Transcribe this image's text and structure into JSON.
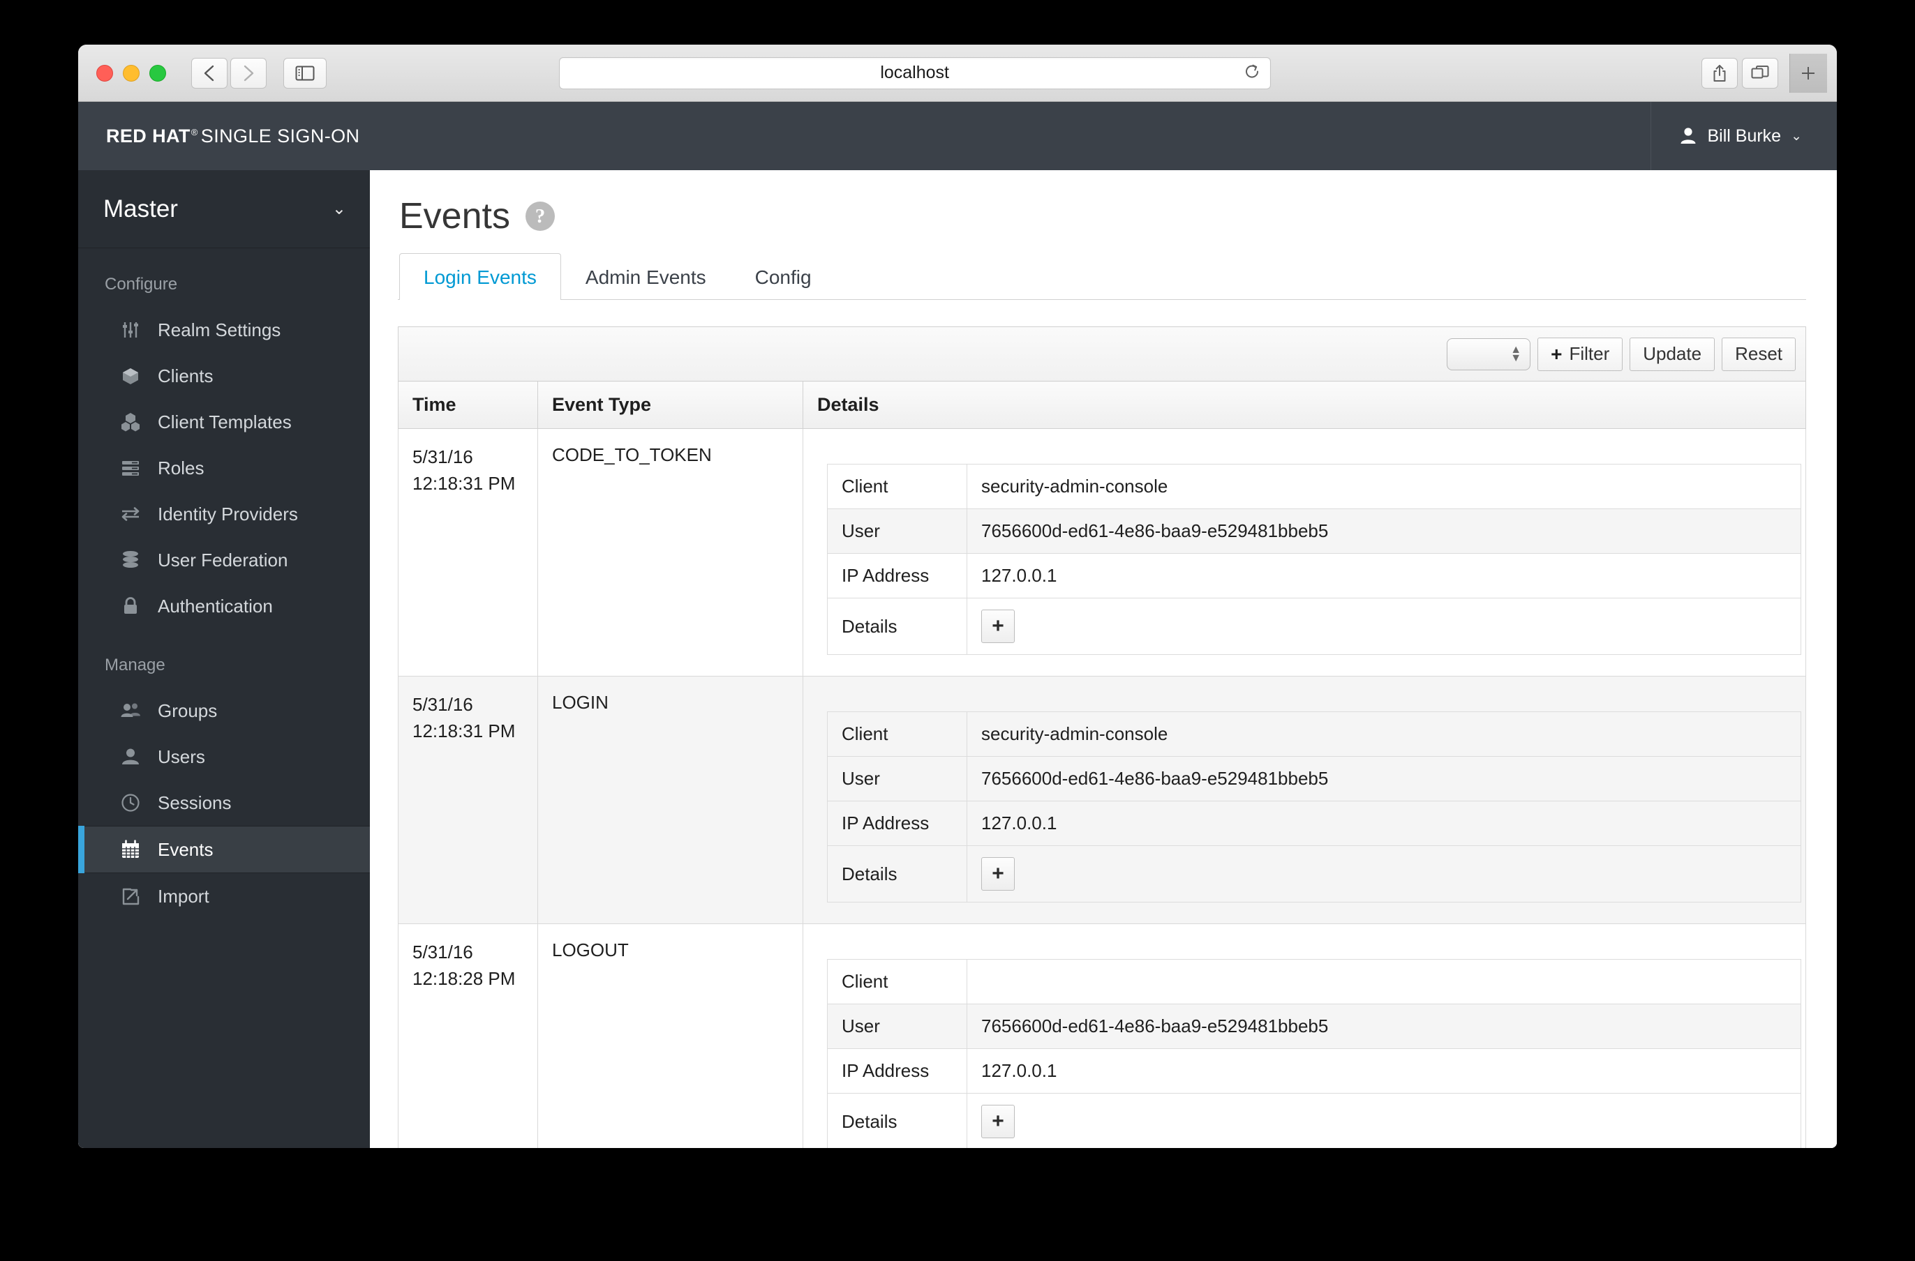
{
  "browser": {
    "url": "localhost",
    "back_label": "Back",
    "forward_label": "Forward",
    "sidebar_label": "Show Sidebar",
    "reload_label": "Reload",
    "share_label": "Share",
    "tabs_label": "Show Tab Overview",
    "newtab_label": "+"
  },
  "header": {
    "brand_bold": "RED HAT",
    "brand_reg": "®",
    "brand_light": "SINGLE SIGN-ON",
    "user_name": "Bill Burke",
    "user_caret": "⌄"
  },
  "sidebar": {
    "realm": "Master",
    "realm_caret": "⌄",
    "sections": [
      {
        "title": "Configure",
        "items": [
          {
            "label": "Realm Settings",
            "icon": "sliders-icon",
            "active": false
          },
          {
            "label": "Clients",
            "icon": "cube-icon",
            "active": false
          },
          {
            "label": "Client Templates",
            "icon": "cubes-icon",
            "active": false
          },
          {
            "label": "Roles",
            "icon": "list-icon",
            "active": false
          },
          {
            "label": "Identity Providers",
            "icon": "exchange-icon",
            "active": false
          },
          {
            "label": "User Federation",
            "icon": "database-icon",
            "active": false
          },
          {
            "label": "Authentication",
            "icon": "lock-icon",
            "active": false
          }
        ]
      },
      {
        "title": "Manage",
        "items": [
          {
            "label": "Groups",
            "icon": "users-icon",
            "active": false
          },
          {
            "label": "Users",
            "icon": "user-icon",
            "active": false
          },
          {
            "label": "Sessions",
            "icon": "clock-icon",
            "active": false
          },
          {
            "label": "Events",
            "icon": "calendar-icon",
            "active": true
          },
          {
            "label": "Import",
            "icon": "import-icon",
            "active": false
          }
        ]
      }
    ]
  },
  "main": {
    "page_title": "Events",
    "help_glyph": "?",
    "tabs": [
      {
        "label": "Login Events",
        "active": true
      },
      {
        "label": "Admin Events",
        "active": false
      },
      {
        "label": "Config",
        "active": false
      }
    ],
    "toolbar": {
      "select_value": "",
      "filter_label": "Filter",
      "filter_plus": "+",
      "update_label": "Update",
      "reset_label": "Reset"
    },
    "table": {
      "columns": [
        "Time",
        "Event Type",
        "Details"
      ],
      "detail_keys": [
        "Client",
        "User",
        "IP Address",
        "Details"
      ],
      "detail_plus": "+",
      "rows": [
        {
          "date": "5/31/16",
          "time": "12:18:31 PM",
          "event_type": "CODE_TO_TOKEN",
          "client": "security-admin-console",
          "user": "7656600d-ed61-4e86-baa9-e529481bbeb5",
          "ip": "127.0.0.1"
        },
        {
          "date": "5/31/16",
          "time": "12:18:31 PM",
          "event_type": "LOGIN",
          "client": "security-admin-console",
          "user": "7656600d-ed61-4e86-baa9-e529481bbeb5",
          "ip": "127.0.0.1"
        },
        {
          "date": "5/31/16",
          "time": "12:18:28 PM",
          "event_type": "LOGOUT",
          "client": "",
          "user": "7656600d-ed61-4e86-baa9-e529481bbeb5",
          "ip": "127.0.0.1"
        }
      ]
    },
    "pagination": {
      "first": "«",
      "prev": "‹",
      "next": "›"
    }
  },
  "colors": {
    "accent": "#39a5dc",
    "link": "#0099d3",
    "header_bg": "#3b4149",
    "sidebar_bg": "#292e34",
    "sidebar_active": "#393f45"
  }
}
